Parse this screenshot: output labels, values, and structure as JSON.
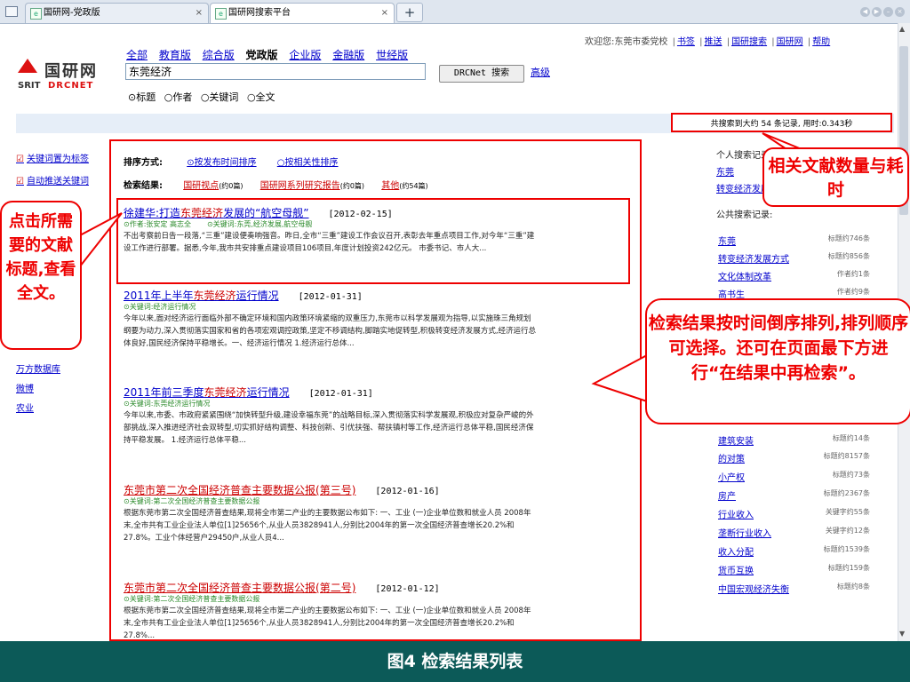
{
  "browser": {
    "tabs": [
      {
        "label": "国研网-党政版",
        "close": "×"
      },
      {
        "label": "国研网搜索平台",
        "close": "×"
      }
    ],
    "new_tab": "+"
  },
  "logo": {
    "cn": "国研网",
    "srit": "SRIT",
    "drcnet": "DRCNET"
  },
  "editions": [
    "全部",
    "教育版",
    "综合版",
    "党政版",
    "企业版",
    "金融版",
    "世经版"
  ],
  "search": {
    "value": "东莞经济",
    "button": "DRCNet 搜索",
    "advanced": "高级"
  },
  "radios": [
    "⊙标题",
    "○作者",
    "○关键词",
    "○全文"
  ],
  "welcome": {
    "text": "欢迎您:东莞市委党校",
    "links": [
      "书签",
      "推送",
      "国研搜索",
      "国研网",
      "帮助"
    ]
  },
  "result_count": "共搜索到大约 54 条记录, 用时:0.343秒",
  "left_nav": [
    "关键词置为标签",
    "自动推送关键词"
  ],
  "left_links": [
    "万方数据库",
    "微博",
    "农业"
  ],
  "sort": {
    "label": "排序方式:",
    "options": [
      "⊙按发布时间排序",
      "○按相关性排序"
    ]
  },
  "results_bar": {
    "label": "检索结果:",
    "cats": [
      {
        "name": "国研视点",
        "count": "(约0篇)"
      },
      {
        "name": "国研网系列研究报告",
        "count": "(约0篇)"
      },
      {
        "name": "其他",
        "count": "(约54篇)"
      }
    ]
  },
  "results": [
    {
      "title_pre": "徐建华:打造",
      "title_hl": "东莞经济",
      "title_post": "发展的“航空母舰”",
      "date": "[2012-02-15]",
      "meta": [
        "⊙作者:张安定 高志全",
        "⊙关键词:东莞,经济发展,航空母舰"
      ],
      "abstract": "不出考察前日告一段落,“三重”建设便奏响强音。昨日,全市“三重”建设工作会议召开,表彰去年重点项目工作,对今年“三重”建设工作进行部署。据悉,今年,我市共安排重点建设项目106项目,年度计划投资242亿元。 市委书记、市人大..."
    },
    {
      "title_pre": "2011年上半年",
      "title_hl": "东莞经济",
      "title_post": "运行情况",
      "date": "[2012-01-31]",
      "meta": [
        "⊙关键词:经济运行情况"
      ],
      "abstract": "今年以来,面对经济运行面临外部不确定环境和国内政策环境紧缩的双重压力,东莞市以科学发展观为指导,以实施珠三角规划纲要为动力,深入贯彻落实国家和省的各项宏观调控政策,坚定不移调结构,脚踏实地促转型,积极转变经济发展方式,经济运行总体良好,国民经济保持平稳增长。一、经济运行情况 1.经济运行总体..."
    },
    {
      "title_pre": "2011年前三季度",
      "title_hl": "东莞经济",
      "title_post": "运行情况",
      "date": "[2012-01-31]",
      "meta": [
        "⊙关键词:东莞经济运行情况"
      ],
      "abstract": "今年以来,市委、市政府紧紧围绕“加快转型升级,建设幸福东莞”的战略目标,深入贯彻落实科学发展观,积极应对复杂严峻的外部挑战,深入推进经济社会双转型,切实抓好结构调整、科技创新、引优扶强、帮扶镇村等工作,经济运行总体平稳,国民经济保持平稳发展。 1.经济运行总体平稳..."
    },
    {
      "title_pre": "东莞市第二次全国",
      "title_hl": "经济",
      "title_post": "普查主要数据公报(第三号)",
      "date": "[2012-01-16]",
      "meta": [
        "⊙关键词:第二次全国经济普查主要数据公报"
      ],
      "abstract": "根据东莞市第二次全国经济普查结果,现将全市第二产业的主要数据公布如下: 一、工业 (一)企业单位数和就业人员 2008年末,全市共有工业企业法人单位[1]25656个,从业人员3828941人,分别比2004年的第一次全国经济普查增长20.2%和27.8%。工业个体经营户29450户,从业人员4..."
    },
    {
      "title_pre": "东莞市第二次全国",
      "title_hl": "经济",
      "title_post": "普查主要数据公报(第二号)",
      "date": "[2012-01-12]",
      "meta": [
        "⊙关键词:第二次全国经济普查主要数据公报"
      ],
      "abstract": "根据东莞市第二次全国经济普查结果,现将全市第二产业的主要数据公布如下: 一、工业 (一)企业单位数和就业人员 2008年末,全市共有工业企业法人单位[1]25656个,从业人员3828941人,分别比2004年的第一次全国经济普查增长20.2%和27.8%..."
    }
  ],
  "personal": {
    "label": "个人搜索记录:",
    "items": [
      "东莞",
      "转变经济发展方式"
    ]
  },
  "public": {
    "label": "公共搜索记录:",
    "items": [
      {
        "name": "东莞",
        "count": "标题约746条"
      },
      {
        "name": "转变经济发展方式",
        "count": "标题约856条"
      },
      {
        "name": "文化体制改革",
        "count": "作者约1条"
      },
      {
        "name": "高书生",
        "count": "作者约9条"
      },
      {
        "name": "建筑安装",
        "count": "标题约14条"
      },
      {
        "name": "的对策",
        "count": "标题约8157条"
      },
      {
        "name": "小产权",
        "count": "标题约73条"
      },
      {
        "name": "房产",
        "count": "标题约2367条"
      },
      {
        "name": "行业收入",
        "count": "关键字约55条"
      },
      {
        "name": "垄断行业收入",
        "count": "关键字约12条"
      },
      {
        "name": "收入分配",
        "count": "标题约1539条"
      },
      {
        "name": "货币互换",
        "count": "标题约159条"
      },
      {
        "name": "中国宏观经济失衡",
        "count": "标题约8条"
      }
    ]
  },
  "callouts": {
    "left": "点击所需要的文献标题,查看全文。",
    "top": "相关文献数量与耗时",
    "right": "检索结果按时间倒序排列,排列顺序可选择。还可在页面最下方进行“在结果中再检索”。"
  },
  "caption": "图4 检索结果列表",
  "colors": {
    "accent": "#ee0000",
    "link": "#0000cc",
    "footer": "#0c5a58"
  }
}
